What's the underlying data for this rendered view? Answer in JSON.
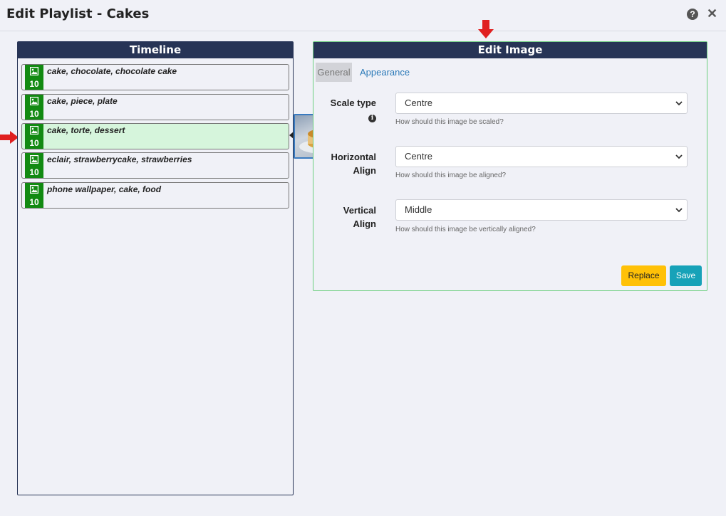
{
  "window": {
    "title": "Edit Playlist - Cakes"
  },
  "timeline": {
    "header": "Timeline",
    "items": [
      {
        "label": "cake, chocolate, chocolate cake",
        "duration": "10",
        "selected": false
      },
      {
        "label": "cake, piece, plate",
        "duration": "10",
        "selected": false
      },
      {
        "label": "cake, torte, dessert",
        "duration": "10",
        "selected": true
      },
      {
        "label": "eclair, strawberrycake, strawberries",
        "duration": "10",
        "selected": false
      },
      {
        "label": "phone wallpaper, cake, food",
        "duration": "10",
        "selected": false
      }
    ]
  },
  "edit": {
    "header": "Edit Image",
    "tabs": {
      "general": "General",
      "appearance": "Appearance"
    },
    "scale_type": {
      "label": "Scale type",
      "value": "Centre",
      "help": "How should this image be scaled?"
    },
    "horizontal_align": {
      "label_line1": "Horizontal",
      "label_line2": "Align",
      "value": "Centre",
      "help": "How should this image be aligned?"
    },
    "vertical_align": {
      "label_line1": "Vertical",
      "label_line2": "Align",
      "value": "Middle",
      "help": "How should this image be vertically aligned?"
    },
    "replace_label": "Replace",
    "save_label": "Save"
  },
  "colors": {
    "header_navy": "#273456",
    "badge_green": "#128a12",
    "selected_row": "#d6f5dc",
    "replace_yellow": "#ffc107",
    "save_teal": "#17a2b8",
    "annotation_red": "#e02020"
  }
}
